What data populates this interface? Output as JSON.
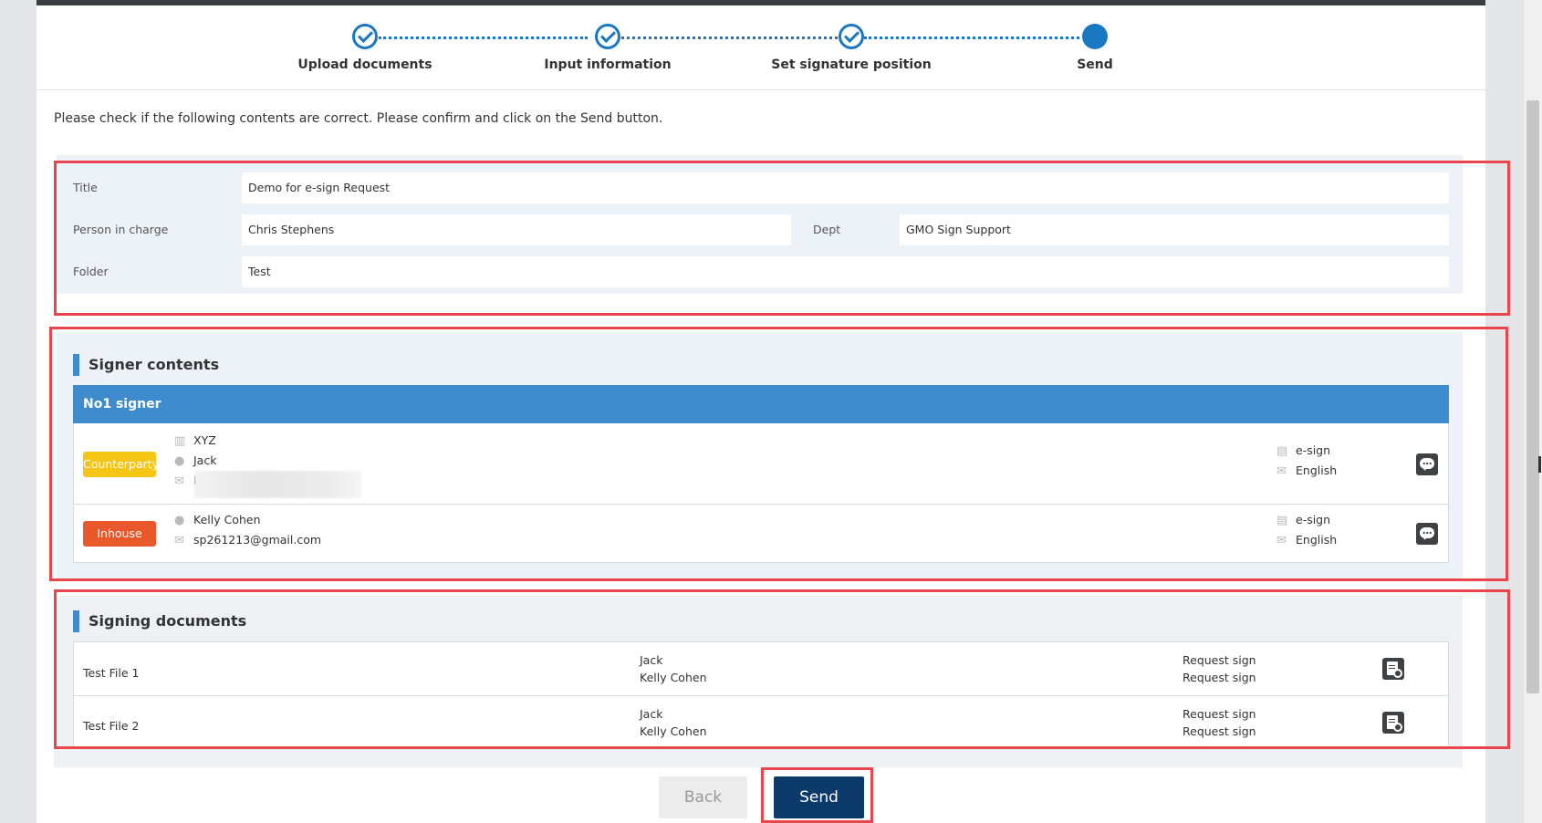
{
  "steps": [
    {
      "label": "Upload documents",
      "state": "done"
    },
    {
      "label": "Input information",
      "state": "done"
    },
    {
      "label": "Set signature position",
      "state": "done"
    },
    {
      "label": "Send",
      "state": "current"
    }
  ],
  "instruction": "Please check if the following contents are correct. Please confirm and click on the Send button.",
  "info": {
    "title_label": "Title",
    "title_value": "Demo for e-sign Request",
    "person_label": "Person in charge",
    "person_value": "Chris Stephens",
    "dept_label": "Dept",
    "dept_value": "GMO Sign Support",
    "folder_label": "Folder",
    "folder_value": "Test"
  },
  "signer_section": {
    "title": "Signer contents",
    "header": "No1 signer",
    "signers": [
      {
        "type": "Counterparty",
        "company": "XYZ",
        "name": "Jack",
        "email": "k",
        "method": "e-sign",
        "language": "English"
      },
      {
        "type": "Inhouse",
        "name": "Kelly Cohen",
        "email": "sp261213@gmail.com",
        "method": "e-sign",
        "language": "English"
      }
    ]
  },
  "documents_section": {
    "title": "Signing documents",
    "documents": [
      {
        "file": "Test File 1",
        "signer1": "Jack",
        "signer2": "Kelly Cohen",
        "action1": "Request sign",
        "action2": "Request sign"
      },
      {
        "file": "Test File 2",
        "signer1": "Jack",
        "signer2": "Kelly Cohen",
        "action1": "Request sign",
        "action2": "Request sign"
      }
    ]
  },
  "buttons": {
    "back": "Back",
    "send": "Send"
  },
  "colors": {
    "accent": "#1a78c2",
    "signer_header": "#3e8ccd",
    "highlight_border": "#e8464d",
    "counterparty_badge": "#f5c518",
    "inhouse_badge": "#e8582a",
    "send_button": "#0b3a6b"
  },
  "icons": {
    "company": "building-icon",
    "person": "person-icon",
    "email": "envelope-icon",
    "method": "document-icon",
    "language": "envelope-icon",
    "comment": "chat-bubble-icon",
    "preview": "document-preview-icon"
  }
}
